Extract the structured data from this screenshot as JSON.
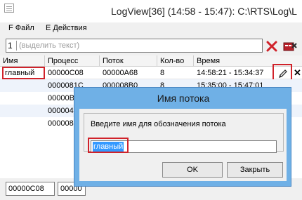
{
  "window": {
    "title": "LogView[36] (14:58 - 15:47): C:\\RTS\\Log\\L"
  },
  "menu": {
    "items": [
      "F Файл",
      "E Действия"
    ]
  },
  "filter": {
    "index": "1",
    "placeholder": "(выделить текст)"
  },
  "table": {
    "columns": [
      "Имя",
      "Процесс",
      "Поток",
      "Кол-во",
      "Время"
    ],
    "rows": [
      {
        "name": "главный",
        "process": "00000C08",
        "thread": "00000A68",
        "count": "8",
        "time": "14:58:21 - 15:34:37"
      },
      {
        "name": "",
        "process": "0000081C",
        "thread": "000008B0",
        "count": "8",
        "time": "15:35:00 - 15:47:01"
      },
      {
        "name": "",
        "process": "00000B",
        "thread": "",
        "count": "",
        "time": ""
      },
      {
        "name": "",
        "process": "000004",
        "thread": "",
        "count": "",
        "time": ""
      },
      {
        "name": "",
        "process": "000008",
        "thread": "",
        "count": "",
        "time": ""
      }
    ]
  },
  "bottom": {
    "field1": "00000C08",
    "field2": "00000"
  },
  "dialog": {
    "title": "Имя потока",
    "prompt": "Введите имя для обозначения потока",
    "value": "главный",
    "ok_label": "OK",
    "close_label": "Закрыть"
  },
  "colors": {
    "highlight_red": "#d0222a",
    "dialog_frame": "#6fb0e6",
    "selection_blue": "#3399ff"
  }
}
